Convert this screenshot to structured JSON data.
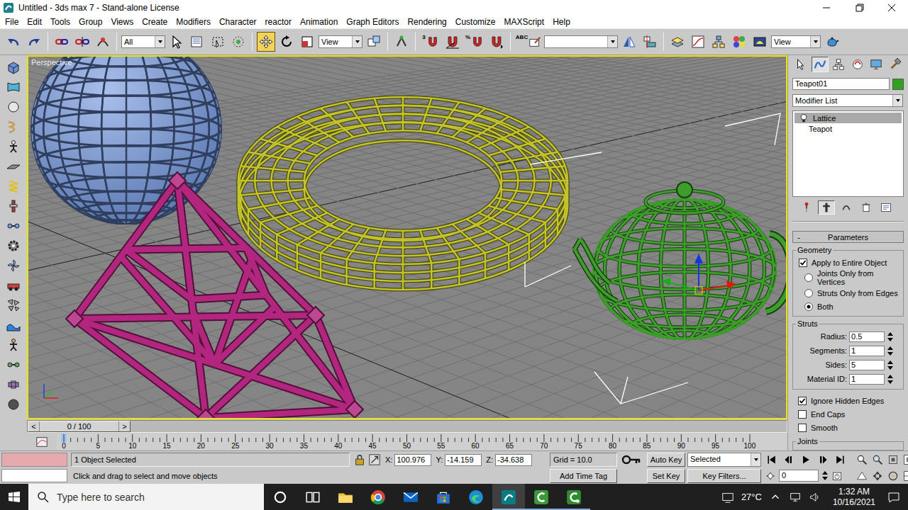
{
  "window": {
    "title": "Untitled - 3ds max 7 - Stand-alone License"
  },
  "menu": [
    "File",
    "Edit",
    "Tools",
    "Group",
    "Views",
    "Create",
    "Modifiers",
    "Character",
    "reactor",
    "Animation",
    "Graph Editors",
    "Rendering",
    "Customize",
    "MAXScript",
    "Help"
  ],
  "main_toolbar": {
    "selection_filter": "All",
    "reference_coordinate_system": "View",
    "render_type": "View",
    "snap_badge": "3",
    "percent_snap_badge": "%",
    "named_selection_badge": "ABC",
    "transform_tools": [
      {
        "kind": "move",
        "selected": true
      },
      {
        "kind": "rotate",
        "selected": false
      },
      {
        "kind": "scale",
        "selected": false
      }
    ]
  },
  "viewport": {
    "label": "Perspective",
    "active": true,
    "objects": [
      {
        "kind": "sphere",
        "color": "#6f95dd",
        "selected": false
      },
      {
        "kind": "torus",
        "color": "#c3c32c",
        "selected": false
      },
      {
        "kind": "pyramid",
        "color": "#b3267f",
        "selected": false
      },
      {
        "kind": "teapot",
        "color": "#3e9e2b",
        "selected": true
      }
    ]
  },
  "command_panel": {
    "tabs": [
      {
        "kind": "create",
        "selected": false
      },
      {
        "kind": "modify",
        "selected": true
      },
      {
        "kind": "hierarchy",
        "selected": false
      },
      {
        "kind": "motion",
        "selected": false
      },
      {
        "kind": "display",
        "selected": false
      },
      {
        "kind": "utilities",
        "selected": false
      }
    ],
    "object_name": "Teapot01",
    "object_color": "#2fa11e",
    "modifier_list": "Modifier List",
    "stack": [
      {
        "label": "Lattice",
        "kind": "modifier",
        "selected": true
      },
      {
        "label": "Teapot",
        "kind": "base",
        "selected": false
      }
    ],
    "stack_buttons": [
      {
        "kind": "pin",
        "pressed": false
      },
      {
        "kind": "show-end-result",
        "pressed": true
      },
      {
        "kind": "make-unique",
        "pressed": false
      },
      {
        "kind": "remove-modifier",
        "pressed": false
      },
      {
        "kind": "configure",
        "pressed": false
      }
    ],
    "rollout": {
      "toggle": "-",
      "title": "Parameters"
    },
    "geometry": {
      "title": "Geometry",
      "apply_to_entire_object": {
        "label": "Apply to Entire Object",
        "checked": true
      },
      "options": [
        {
          "label": "Joints Only from Vertices",
          "selected": false
        },
        {
          "label": "Struts Only from Edges",
          "selected": false
        },
        {
          "label": "Both",
          "selected": true
        }
      ]
    },
    "struts": {
      "title": "Struts",
      "spinners": [
        {
          "label": "Radius:",
          "value": "0.5"
        },
        {
          "label": "Segments:",
          "value": "1"
        },
        {
          "label": "Sides:",
          "value": "5"
        },
        {
          "label": "Material ID:",
          "value": "1"
        }
      ],
      "options": [
        {
          "label": "Ignore Hidden Edges",
          "checked": true
        },
        {
          "label": "End Caps",
          "checked": false
        },
        {
          "label": "Smooth",
          "checked": false
        }
      ]
    },
    "joints": {
      "title": "Joints"
    }
  },
  "time_slider": {
    "label": "0 / 100",
    "prev": "<",
    "next": ">",
    "level": 0
  },
  "track_bar": {
    "ticks": [
      "0",
      "5",
      "10",
      "15",
      "20",
      "25",
      "30",
      "35",
      "40",
      "45",
      "50",
      "55",
      "60",
      "65",
      "70",
      "75",
      "80",
      "85",
      "90",
      "95",
      "100"
    ]
  },
  "status_bar": {
    "selection": "1 Object Selected",
    "prompt": "Click and drag to select and move objects",
    "coordinates": [
      {
        "label": "X:",
        "value": "100.976"
      },
      {
        "label": "Y:",
        "value": "-14.159"
      },
      {
        "label": "Z:",
        "value": "-34.638"
      }
    ],
    "grid": "Grid = 10.0",
    "time_tag": "Add Time Tag",
    "auto_key": {
      "label": "Auto Key",
      "on": false
    },
    "set_key": "Set Key",
    "key_set": "Selected",
    "key_filters": "Key Filters...",
    "frame": "0"
  },
  "taskbar": {
    "search_placeholder": "Type here to search",
    "apps": [
      {
        "kind": "cortana",
        "active": false,
        "running": false
      },
      {
        "kind": "task-view",
        "active": false,
        "running": false
      },
      {
        "kind": "file-explorer",
        "active": false,
        "running": false
      },
      {
        "kind": "chrome",
        "active": false,
        "running": false
      },
      {
        "kind": "mail",
        "active": false,
        "running": false
      },
      {
        "kind": "store",
        "active": false,
        "running": false
      },
      {
        "kind": "edge",
        "active": false,
        "running": false
      },
      {
        "kind": "3ds-max",
        "active": true,
        "running": true
      },
      {
        "kind": "camtasia-recorder",
        "active": false,
        "running": true
      },
      {
        "kind": "camtasia",
        "active": false,
        "running": true
      }
    ],
    "weather": "27°C",
    "time": "1:32 AM",
    "date": "10/16/2021"
  }
}
